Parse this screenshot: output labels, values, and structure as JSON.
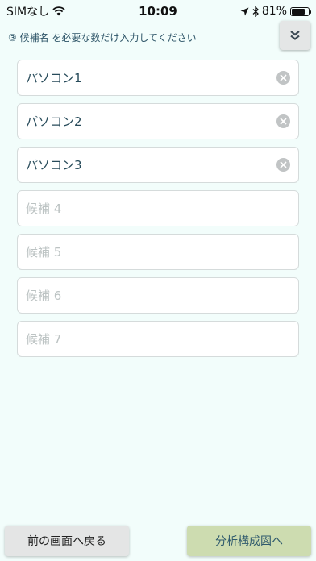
{
  "status_bar": {
    "carrier": "SIMなし",
    "time": "10:09",
    "battery_pct": "81%",
    "battery_level": 0.81
  },
  "instruction": "③ 候補名 を必要な数だけ入力してください",
  "fields": [
    {
      "value": "パソコン1",
      "placeholder": ""
    },
    {
      "value": "パソコン2",
      "placeholder": ""
    },
    {
      "value": "パソコン3",
      "placeholder": ""
    },
    {
      "value": "",
      "placeholder": "候補 4"
    },
    {
      "value": "",
      "placeholder": "候補 5"
    },
    {
      "value": "",
      "placeholder": "候補 6"
    },
    {
      "value": "",
      "placeholder": "候補 7"
    }
  ],
  "buttons": {
    "back": "前の画面へ戻る",
    "next": "分析構成図へ"
  },
  "colors": {
    "background": "#f2fdfb",
    "next_button": "#cddcb0",
    "back_button": "#e4e5e5"
  }
}
